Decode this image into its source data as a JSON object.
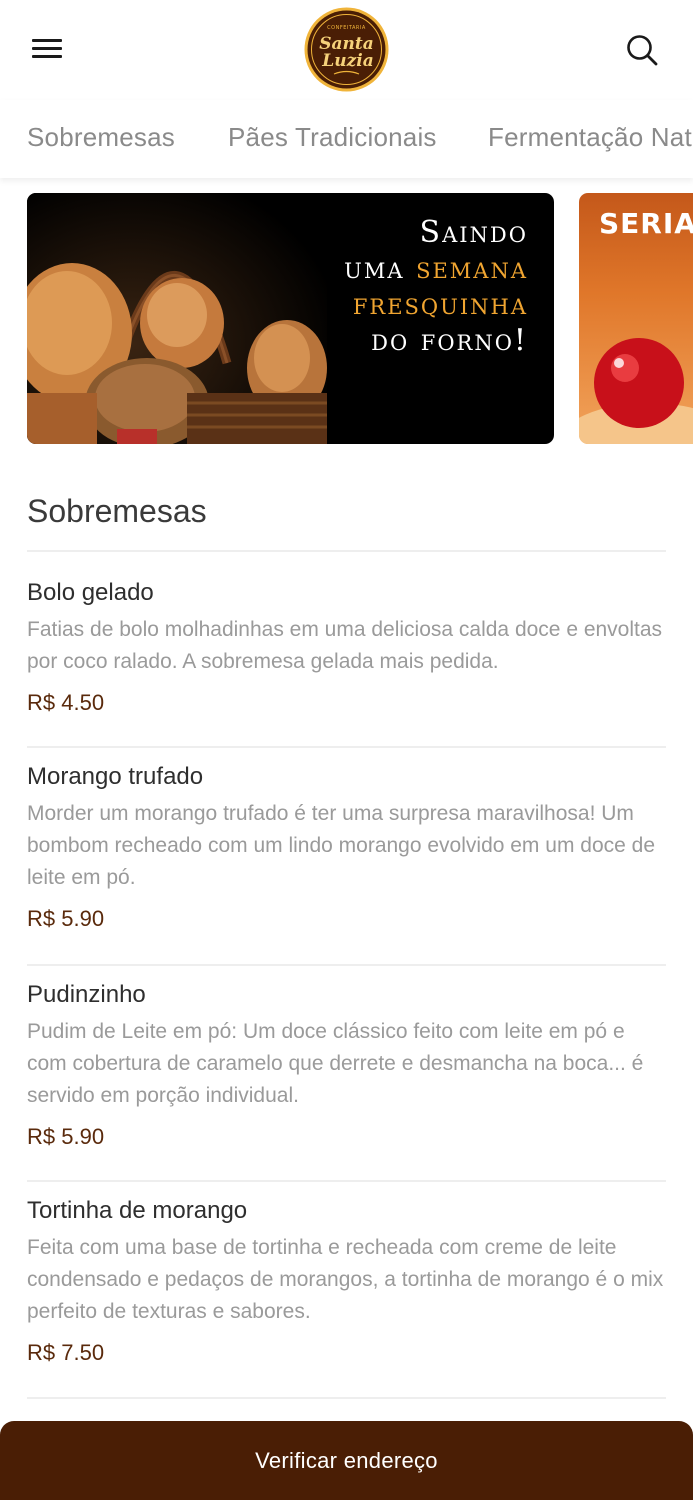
{
  "header": {
    "logo": {
      "small_text": "CONFEITARIA",
      "line1": "Santa",
      "line2": "Luzia"
    }
  },
  "tabs": [
    "Sobremesas",
    "Pães Tradicionais",
    "Fermentação Nat"
  ],
  "banners": [
    {
      "line1": "Saindo",
      "line2_a": "uma ",
      "line2_b": "semana",
      "line3": "fresquinha",
      "line4": "do forno!"
    },
    {
      "text": "SERIA"
    }
  ],
  "section": {
    "title": "Sobremesas"
  },
  "items": [
    {
      "name": "Bolo gelado",
      "description": "Fatias de bolo molhadinhas em uma deliciosa calda doce e envoltas por coco ralado. A sobremesa gelada mais pedida.",
      "price": "R$ 4.50"
    },
    {
      "name": "Morango trufado",
      "description": "Morder um morango trufado é ter uma surpresa maravilhosa! Um bombom recheado com um lindo morango evolvido em um doce de leite em pó.",
      "price": "R$ 5.90"
    },
    {
      "name": "Pudinzinho",
      "description": "Pudim de Leite em pó: Um doce clássico feito com leite em pó e com cobertura de caramelo que derrete e desmancha na boca... é servido em porção individual.",
      "price": "R$ 5.90"
    },
    {
      "name": "Tortinha de morango",
      "description": "Feita com uma base de tortinha e recheada com creme de leite condensado e pedaços de morangos, a tortinha de morango é o mix perfeito de texturas e sabores.",
      "price": "R$ 7.50"
    }
  ],
  "cta": {
    "label": "Verificar endereço"
  },
  "colors": {
    "brand_dark": "#4a1e05",
    "price": "#5a2a0c",
    "banner_gold": "#f0a531"
  },
  "icons": {
    "menu": "hamburger-menu-icon",
    "search": "search-icon"
  }
}
